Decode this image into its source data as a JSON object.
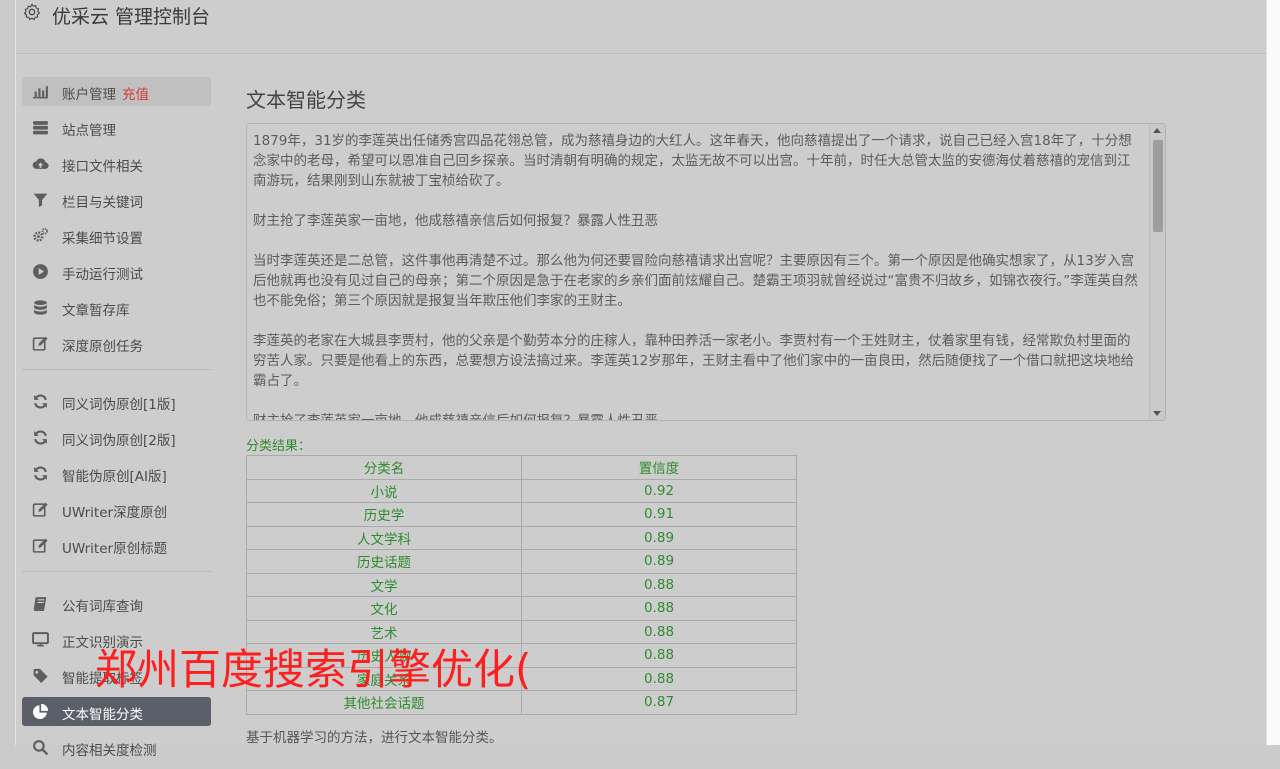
{
  "header": {
    "title": "优采云 管理控制台",
    "icon": "gear-icon"
  },
  "sidebar": {
    "groups": [
      [
        {
          "label": "账户管理",
          "badge": "充值",
          "icon": "bar-chart-icon",
          "state": "highlight"
        },
        {
          "label": "站点管理",
          "icon": "server-icon"
        },
        {
          "label": "接口文件相关",
          "icon": "cloud-upload-icon"
        },
        {
          "label": "栏目与关键词",
          "icon": "filter-icon"
        },
        {
          "label": "采集细节设置",
          "icon": "gears-icon"
        },
        {
          "label": "手动运行测试",
          "icon": "play-circle-icon"
        },
        {
          "label": "文章暂存库",
          "icon": "database-icon"
        },
        {
          "label": "深度原创任务",
          "icon": "edit-icon"
        }
      ],
      [
        {
          "label": "同义词伪原创[1版]",
          "icon": "refresh-icon"
        },
        {
          "label": "同义词伪原创[2版]",
          "icon": "refresh-icon"
        },
        {
          "label": "智能伪原创[AI版]",
          "icon": "refresh-icon"
        },
        {
          "label": "UWriter深度原创",
          "icon": "edit-icon"
        },
        {
          "label": "UWriter原创标题",
          "icon": "edit-icon"
        }
      ],
      [
        {
          "label": "公有词库查询",
          "icon": "book-icon"
        },
        {
          "label": "正文识别演示",
          "icon": "monitor-icon"
        },
        {
          "label": "智能提取标签",
          "icon": "tag-icon"
        },
        {
          "label": "文本智能分类",
          "icon": "pie-chart-icon",
          "state": "active"
        },
        {
          "label": "内容相关度检测",
          "icon": "search-icon"
        }
      ]
    ]
  },
  "main": {
    "title": "文本智能分类",
    "paragraphs": [
      "1879年，31岁的李莲英出任储秀宫四品花翎总管，成为慈禧身边的大红人。这年春天，他向慈禧提出了一个请求，说自己已经入宫18年了，十分想念家中的老母，希望可以恩准自己回乡探亲。当时清朝有明确的规定，太监无故不可以出宫。十年前，时任大总管太监的安德海仗着慈禧的宠信到江南游玩，结果刚到山东就被丁宝桢给砍了。",
      "财主抢了李莲英家一亩地，他成慈禧亲信后如何报复？暴露人性丑恶",
      "当时李莲英还是二总管，这件事他再清楚不过。那么他为何还要冒险向慈禧请求出宫呢？主要原因有三个。第一个原因是他确实想家了，从13岁入宫后他就再也没有见过自己的母亲；第二个原因是急于在老家的乡亲们面前炫耀自己。楚霸王项羽就曾经说过“富贵不归故乡，如锦衣夜行。”李莲英自然也不能免俗；第三个原因就是报复当年欺压他们李家的王财主。",
      "李莲英的老家在大城县李贾村，他的父亲是个勤劳本分的庄稼人，靠种田养活一家老小。李贾村有一个王姓财主，仗着家里有钱，经常欺负村里面的穷苦人家。只要是他看上的东西，总要想方设法搞过来。李莲英12岁那年，王财主看中了他们家中的一亩良田，然后随便找了一个借口就把这块地给霸占了。",
      "财主抢了李莲英家一亩地，他成慈禧亲信后如何报复？暴露人性丑恶"
    ],
    "result_label": "分类结果：",
    "table": {
      "headers": [
        "分类名",
        "置信度"
      ],
      "rows": [
        [
          "小说",
          "0.92"
        ],
        [
          "历史学",
          "0.91"
        ],
        [
          "人文学科",
          "0.89"
        ],
        [
          "历史话题",
          "0.89"
        ],
        [
          "文学",
          "0.88"
        ],
        [
          "文化",
          "0.88"
        ],
        [
          "艺术",
          "0.88"
        ],
        [
          "历史人物",
          "0.88"
        ],
        [
          "家庭关系",
          "0.88"
        ],
        [
          "其他社会话题",
          "0.87"
        ]
      ]
    },
    "footnote": "基于机器学习的方法，进行文本智能分类。"
  },
  "watermark": "郑州百度搜索引擎优化(",
  "colors": {
    "accent_green": "#2e8b2e",
    "active_nav": "#5b5f69",
    "badge_red": "#d23b3b",
    "watermark_red": "#ff1e1e"
  }
}
